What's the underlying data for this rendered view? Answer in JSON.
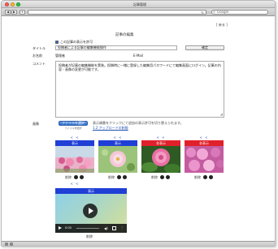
{
  "window": {
    "title": "記事管理"
  },
  "toolbar": {
    "search_placeholder": "Google",
    "reload_glyph": "↻",
    "back_glyph": "◀",
    "forward_glyph": "▶",
    "add_glyph": "+"
  },
  "page": {
    "back_link": "[ 戻る ]",
    "title": "記事の編集",
    "publish_checkbox_label": "この記事の表示を許可",
    "title_label": "タイトル",
    "title_value": "投稿者による記事の編集機能操作",
    "confirm_button": "確定",
    "name_label": "お名前",
    "name_value": "管理者",
    "email_label": "E-Mail",
    "comment_label": "コメント",
    "comment_text": "投稿者が記事の編集機能を実装。投稿時に一緒に登録した編集用パスワードにて編集画面にログイン。記事の内容・画像の変更が可能です。",
    "image_label": "画像",
    "file_button": "ファイルを選択",
    "file_note": "ファイル未選択",
    "image_help": "表示順番をクリックにて追加の表示許可を切り替えられます。",
    "upload_limit_link": "1.2 アップロードの制限"
  },
  "cards": [
    {
      "arrows": "< <",
      "header": "表示",
      "header_color": "#1f3fd6",
      "delete": "削除",
      "thumb": "pink-flowers-field"
    },
    {
      "arrows": "< <",
      "header": "表示",
      "header_color": "#1f3fd6",
      "delete": "削除",
      "thumb": "pink-blossom"
    },
    {
      "arrows": "< <",
      "header": "非表示",
      "header_color": "#e0202a",
      "delete": "削除",
      "thumb": "pink-rose"
    },
    {
      "arrows": "< <",
      "header": "非表示",
      "header_color": "#e0202a",
      "delete": "削除",
      "thumb": "pink-flowers-bush"
    }
  ],
  "video": {
    "arrows": "< <",
    "header": "表示",
    "time": "0:00",
    "volume_glyph": "◀)",
    "more_glyph": "⋮",
    "delete": "削除"
  },
  "colors": {
    "show": "#1f3fd6",
    "hide": "#e0202a",
    "link": "#1f4fb0"
  }
}
